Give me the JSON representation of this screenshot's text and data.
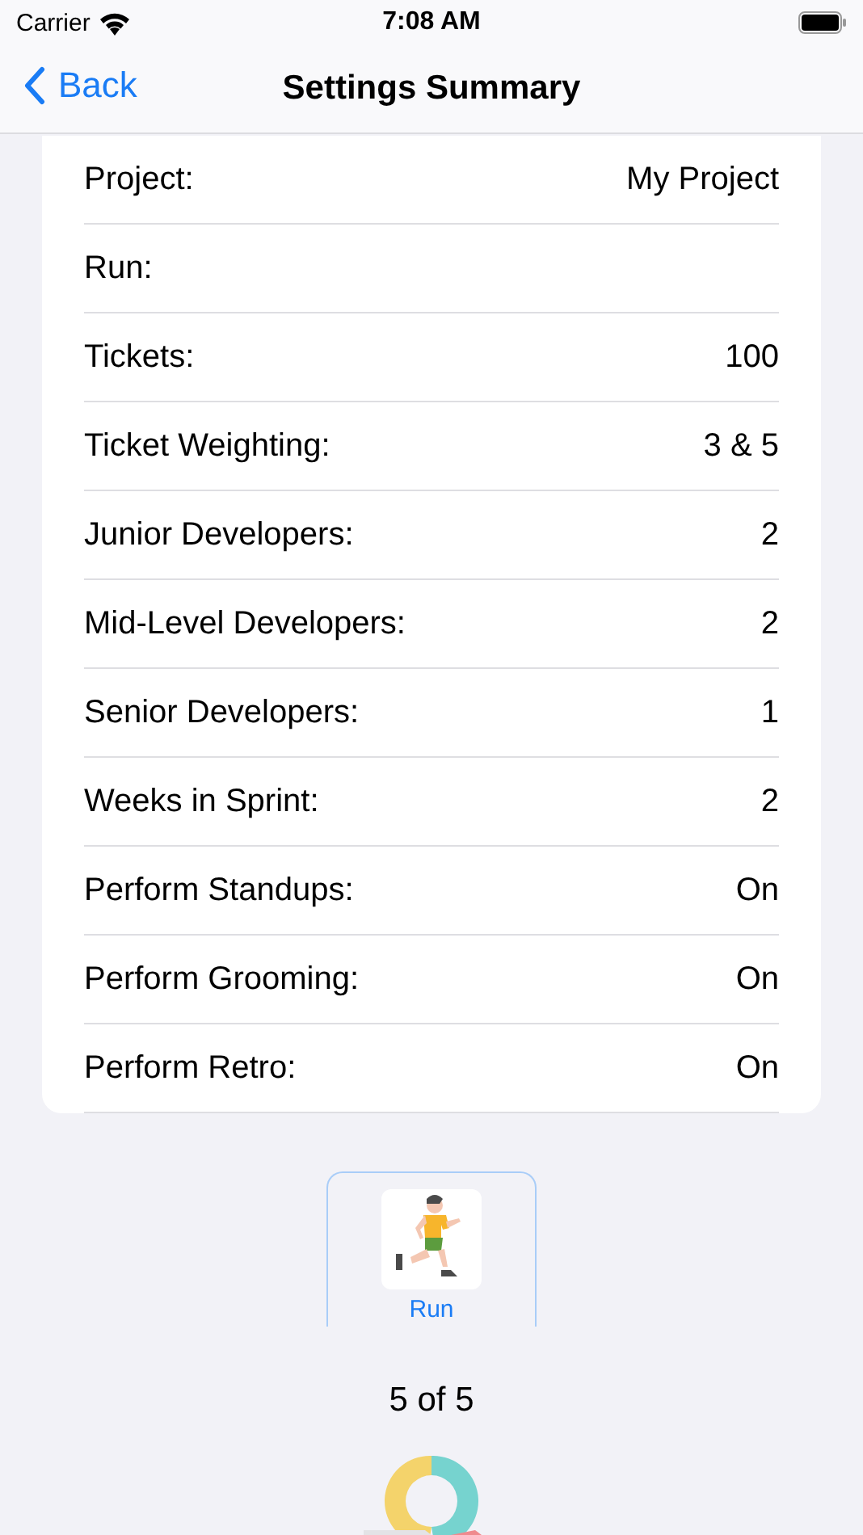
{
  "status_bar": {
    "carrier": "Carrier",
    "time": "7:08 AM"
  },
  "nav": {
    "back": "Back",
    "title": "Settings Summary"
  },
  "settings": [
    {
      "label": "Project:",
      "value": "My Project"
    },
    {
      "label": "Run:"
    },
    {
      "label": "Tickets:",
      "value": "100"
    },
    {
      "label": "Ticket Weighting:",
      "value": "3 & 5"
    },
    {
      "label": "Junior Developers:",
      "value": "2"
    },
    {
      "label": "Mid-Level Developers:",
      "value": "2"
    },
    {
      "label": "Senior Developers:",
      "value": "1"
    },
    {
      "label": "Weeks in Sprint:",
      "value": "2"
    },
    {
      "label": "Perform Standups:",
      "value": "On"
    },
    {
      "label": "Perform Grooming:",
      "value": "On"
    },
    {
      "label": "Perform Retro:",
      "value": "On"
    }
  ],
  "run_button": {
    "label": "Run"
  },
  "page_indicator": "5 of 5"
}
